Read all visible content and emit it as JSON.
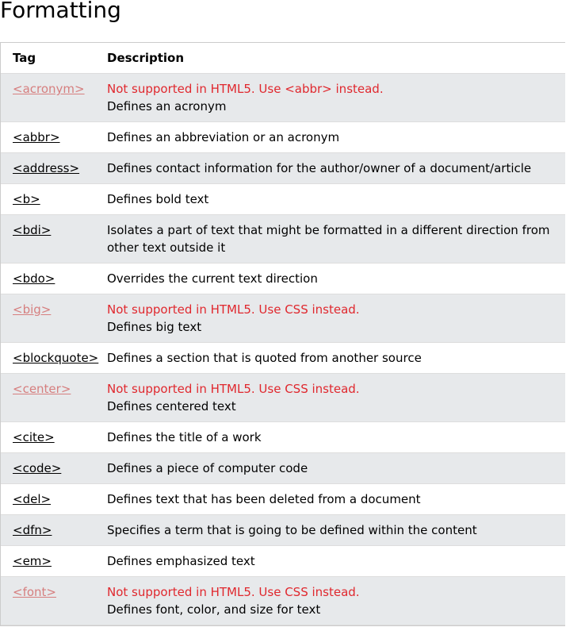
{
  "page": {
    "title": "Formatting"
  },
  "colors": {
    "shaded_row": "#e7e9eb",
    "notice_red": "#e0282e",
    "deprecated_link": "#d67f7f",
    "border": "#dddddd"
  },
  "table": {
    "headers": {
      "tag": "Tag",
      "description": "Description"
    },
    "rows": [
      {
        "tag": "<acronym>",
        "deprecated": true,
        "notice": "Not supported in HTML5. Use <abbr> instead.",
        "description": "Defines an acronym"
      },
      {
        "tag": "<abbr>",
        "deprecated": false,
        "description": "Defines an abbreviation or an acronym"
      },
      {
        "tag": "<address>",
        "deprecated": false,
        "description": "Defines contact information for the author/owner of a document/article"
      },
      {
        "tag": "<b>",
        "deprecated": false,
        "description": "Defines bold text"
      },
      {
        "tag": "<bdi>",
        "deprecated": false,
        "description": "Isolates a part of text that might be formatted in a different direction from other text outside it"
      },
      {
        "tag": "<bdo>",
        "deprecated": false,
        "description": "Overrides the current text direction"
      },
      {
        "tag": "<big>",
        "deprecated": true,
        "notice": "Not supported in HTML5. Use CSS instead.",
        "description": "Defines big text"
      },
      {
        "tag": "<blockquote>",
        "deprecated": false,
        "description": "Defines a section that is quoted from another source"
      },
      {
        "tag": "<center>",
        "deprecated": true,
        "notice": "Not supported in HTML5. Use CSS instead.",
        "description": "Defines centered text"
      },
      {
        "tag": "<cite>",
        "deprecated": false,
        "description": "Defines the title of a work"
      },
      {
        "tag": "<code>",
        "deprecated": false,
        "description": "Defines a piece of computer code"
      },
      {
        "tag": "<del>",
        "deprecated": false,
        "description": "Defines text that has been deleted from a document"
      },
      {
        "tag": "<dfn>",
        "deprecated": false,
        "description": "Specifies a term that is going to be defined within the content"
      },
      {
        "tag": "<em>",
        "deprecated": false,
        "description": "Defines emphasized text"
      },
      {
        "tag": "<font>",
        "deprecated": true,
        "notice": "Not supported in HTML5. Use CSS instead.",
        "description": "Defines font, color, and size for text"
      }
    ]
  }
}
